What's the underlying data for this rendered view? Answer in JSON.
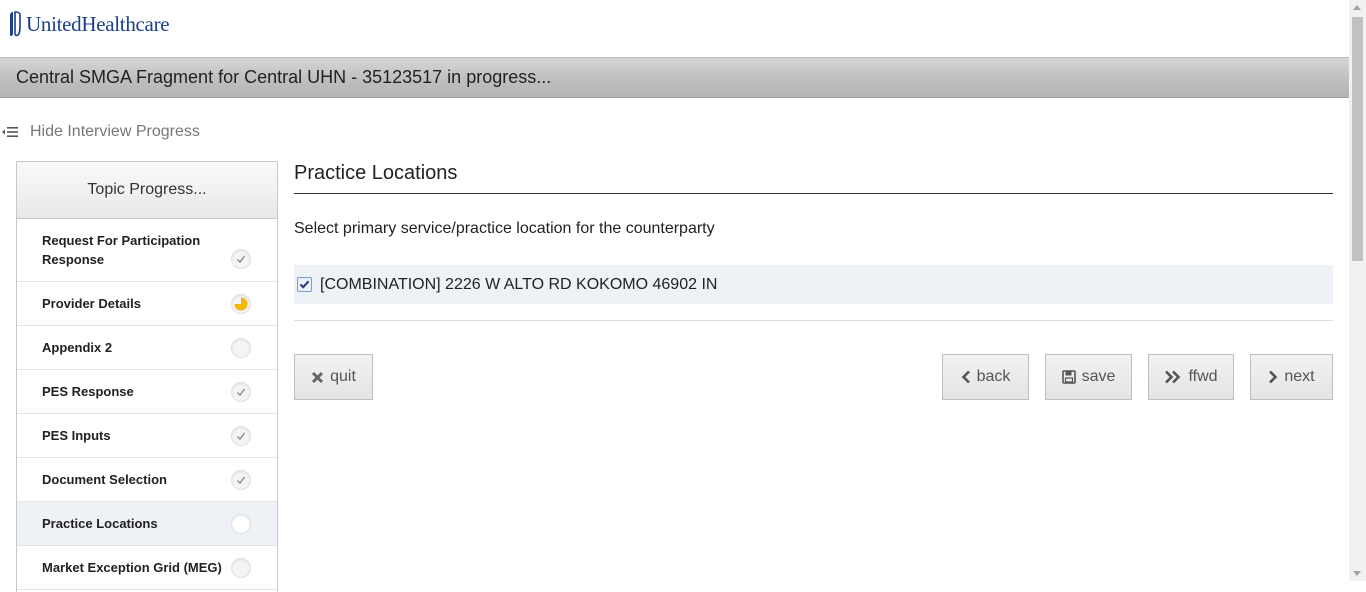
{
  "brand": {
    "name": "UnitedHealthcare",
    "color": "#1b3f8b"
  },
  "title_bar": {
    "title": "Central SMGA Fragment for Central UHN - 35123517 in progress..."
  },
  "progress_toggle": {
    "label": "Hide Interview Progress",
    "icon": "collapse-list-icon"
  },
  "topic_panel": {
    "heading": "Topic Progress...",
    "topics": [
      {
        "label": "Request For Participation Response",
        "status": "complete"
      },
      {
        "label": "Provider Details",
        "status": "in-progress"
      },
      {
        "label": "Appendix 2",
        "status": "not-started"
      },
      {
        "label": "PES Response",
        "status": "complete"
      },
      {
        "label": "PES Inputs",
        "status": "complete"
      },
      {
        "label": "Document Selection",
        "status": "complete"
      },
      {
        "label": "Practice Locations",
        "status": "current"
      },
      {
        "label": "Market Exception Grid (MEG)",
        "status": "not-started"
      }
    ]
  },
  "main": {
    "section_title": "Practice Locations",
    "prompt": "Select primary service/practice location for the counterparty",
    "option": {
      "label": "[COMBINATION] 2226 W ALTO RD KOKOMO 46902 IN",
      "checked": true
    }
  },
  "buttons": {
    "quit": "quit",
    "back": "back",
    "save": "save",
    "ffwd": "ffwd",
    "next": "next"
  },
  "colors": {
    "in_progress": "#f2b705",
    "accent_bg": "#eef1f6"
  }
}
